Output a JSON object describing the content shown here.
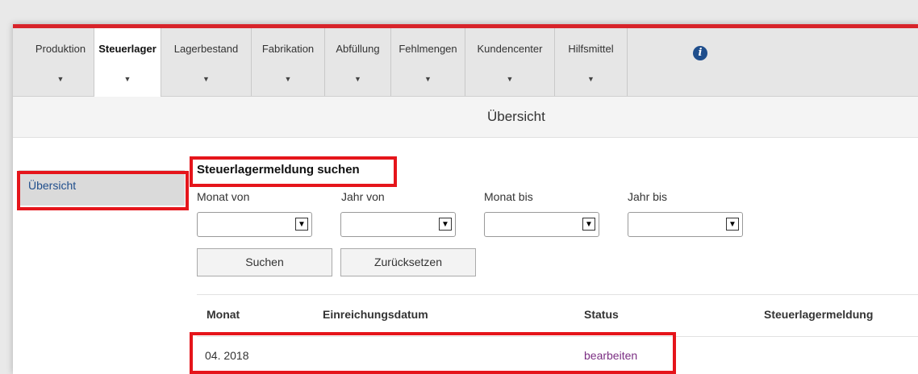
{
  "nav": {
    "tabs": [
      {
        "label": "Produktion"
      },
      {
        "label": "Steuerlager"
      },
      {
        "label": "Lagerbestand"
      },
      {
        "label": "Fabrikation"
      },
      {
        "label": "Abfüllung"
      },
      {
        "label": "Fehlmengen"
      },
      {
        "label": "Kundencenter"
      },
      {
        "label": "Hilfsmittel"
      }
    ],
    "active_tab": "Steuerlager",
    "caret": "▼",
    "info_glyph": "i"
  },
  "page": {
    "title": "Übersicht"
  },
  "sidebar": {
    "items": [
      {
        "label": "Übersicht",
        "active": true
      }
    ]
  },
  "search": {
    "heading": "Steuerlagermeldung suchen",
    "fields": [
      {
        "label": "Monat von",
        "value": ""
      },
      {
        "label": "Jahr von",
        "value": ""
      },
      {
        "label": "Monat bis",
        "value": ""
      },
      {
        "label": "Jahr bis",
        "value": ""
      }
    ],
    "dropdown_arrow": "▼",
    "search_button": "Suchen",
    "reset_button": "Zurücksetzen"
  },
  "table": {
    "columns": [
      "Monat",
      "Einreichungsdatum",
      "Status",
      "Steuerlagermeldung"
    ],
    "rows": [
      {
        "monat": "04. 2018",
        "einreichungsdatum": "",
        "status": "bearbeiten",
        "steuerlagermeldung": ""
      }
    ]
  },
  "colors": {
    "brand_red": "#d8232a",
    "highlight_red": "#e5151b",
    "link_blue": "#1f4e8c",
    "link_purple": "#7b2f83"
  }
}
